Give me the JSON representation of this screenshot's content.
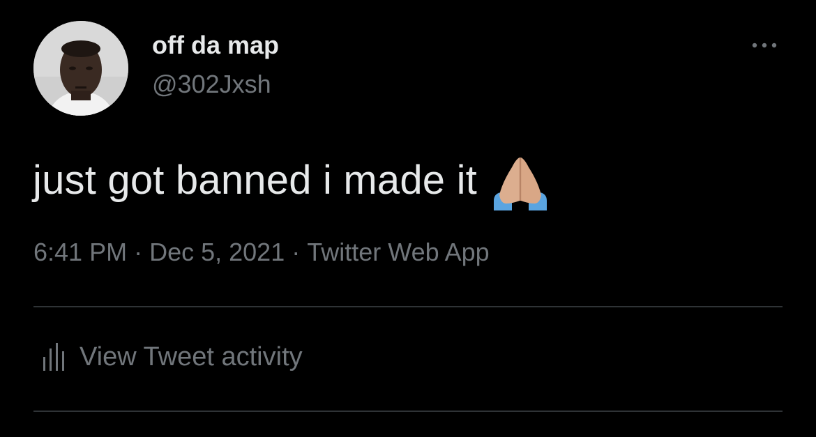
{
  "author": {
    "display_name": "off da map",
    "handle": "@302Jxsh",
    "avatar_icon": "profile-photo"
  },
  "tweet": {
    "text": "just got banned i made it",
    "emoji_icon": "folded-hands-emoji"
  },
  "meta": {
    "time": "6:41 PM",
    "separator": "·",
    "date": "Dec 5, 2021",
    "source": "Twitter Web App"
  },
  "activity": {
    "label": "View Tweet activity",
    "icon": "bar-chart-icon"
  },
  "more_icon": "more-horizontal-icon",
  "colors": {
    "background": "#000000",
    "primary_text": "#e7e9ea",
    "secondary_text": "#71767b",
    "divider": "#2f3336",
    "skin": "#dcae8f",
    "sleeve": "#5aa4e0"
  }
}
